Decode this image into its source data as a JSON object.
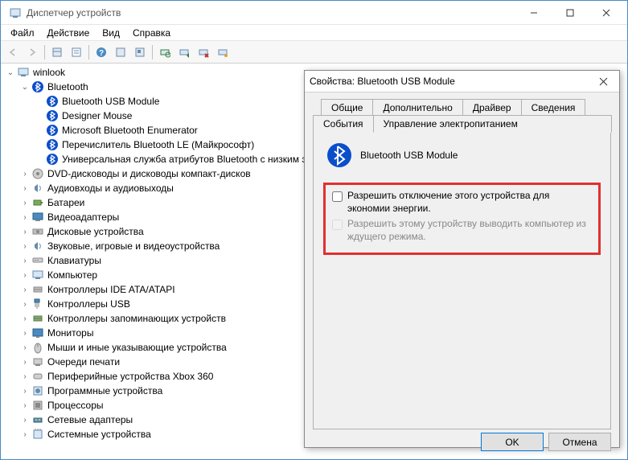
{
  "window": {
    "title": "Диспетчер устройств"
  },
  "menu": {
    "file": "Файл",
    "action": "Действие",
    "view": "Вид",
    "help": "Справка"
  },
  "tree": {
    "root": "winlook",
    "bluetooth": {
      "label": "Bluetooth",
      "children": [
        "Bluetooth USB Module",
        "Designer Mouse",
        "Microsoft Bluetooth Enumerator",
        "Перечислитель Bluetooth LE (Майкрософт)",
        "Универсальная служба атрибутов Bluetooth с низким э..."
      ]
    },
    "categories": [
      "DVD-дисководы и дисководы компакт-дисков",
      "Аудиовходы и аудиовыходы",
      "Батареи",
      "Видеоадаптеры",
      "Дисковые устройства",
      "Звуковые, игровые и видеоустройства",
      "Клавиатуры",
      "Компьютер",
      "Контроллеры IDE ATA/ATAPI",
      "Контроллеры USB",
      "Контроллеры запоминающих устройств",
      "Мониторы",
      "Мыши и иные указывающие устройства",
      "Очереди печати",
      "Периферийные устройства Xbox 360",
      "Программные устройства",
      "Процессоры",
      "Сетевые адаптеры",
      "Системные устройства"
    ]
  },
  "dialog": {
    "title": "Свойства: Bluetooth USB Module",
    "tabs": {
      "general": "Общие",
      "advanced": "Дополнительно",
      "driver": "Драйвер",
      "details": "Сведения",
      "events": "События",
      "power": "Управление электропитанием"
    },
    "device_name": "Bluetooth USB Module",
    "checkbox1": "Разрешить отключение этого устройства для экономии энергии.",
    "checkbox2": "Разрешить этому устройству выводить компьютер из ждущего режима.",
    "ok": "OK",
    "cancel": "Отмена"
  }
}
